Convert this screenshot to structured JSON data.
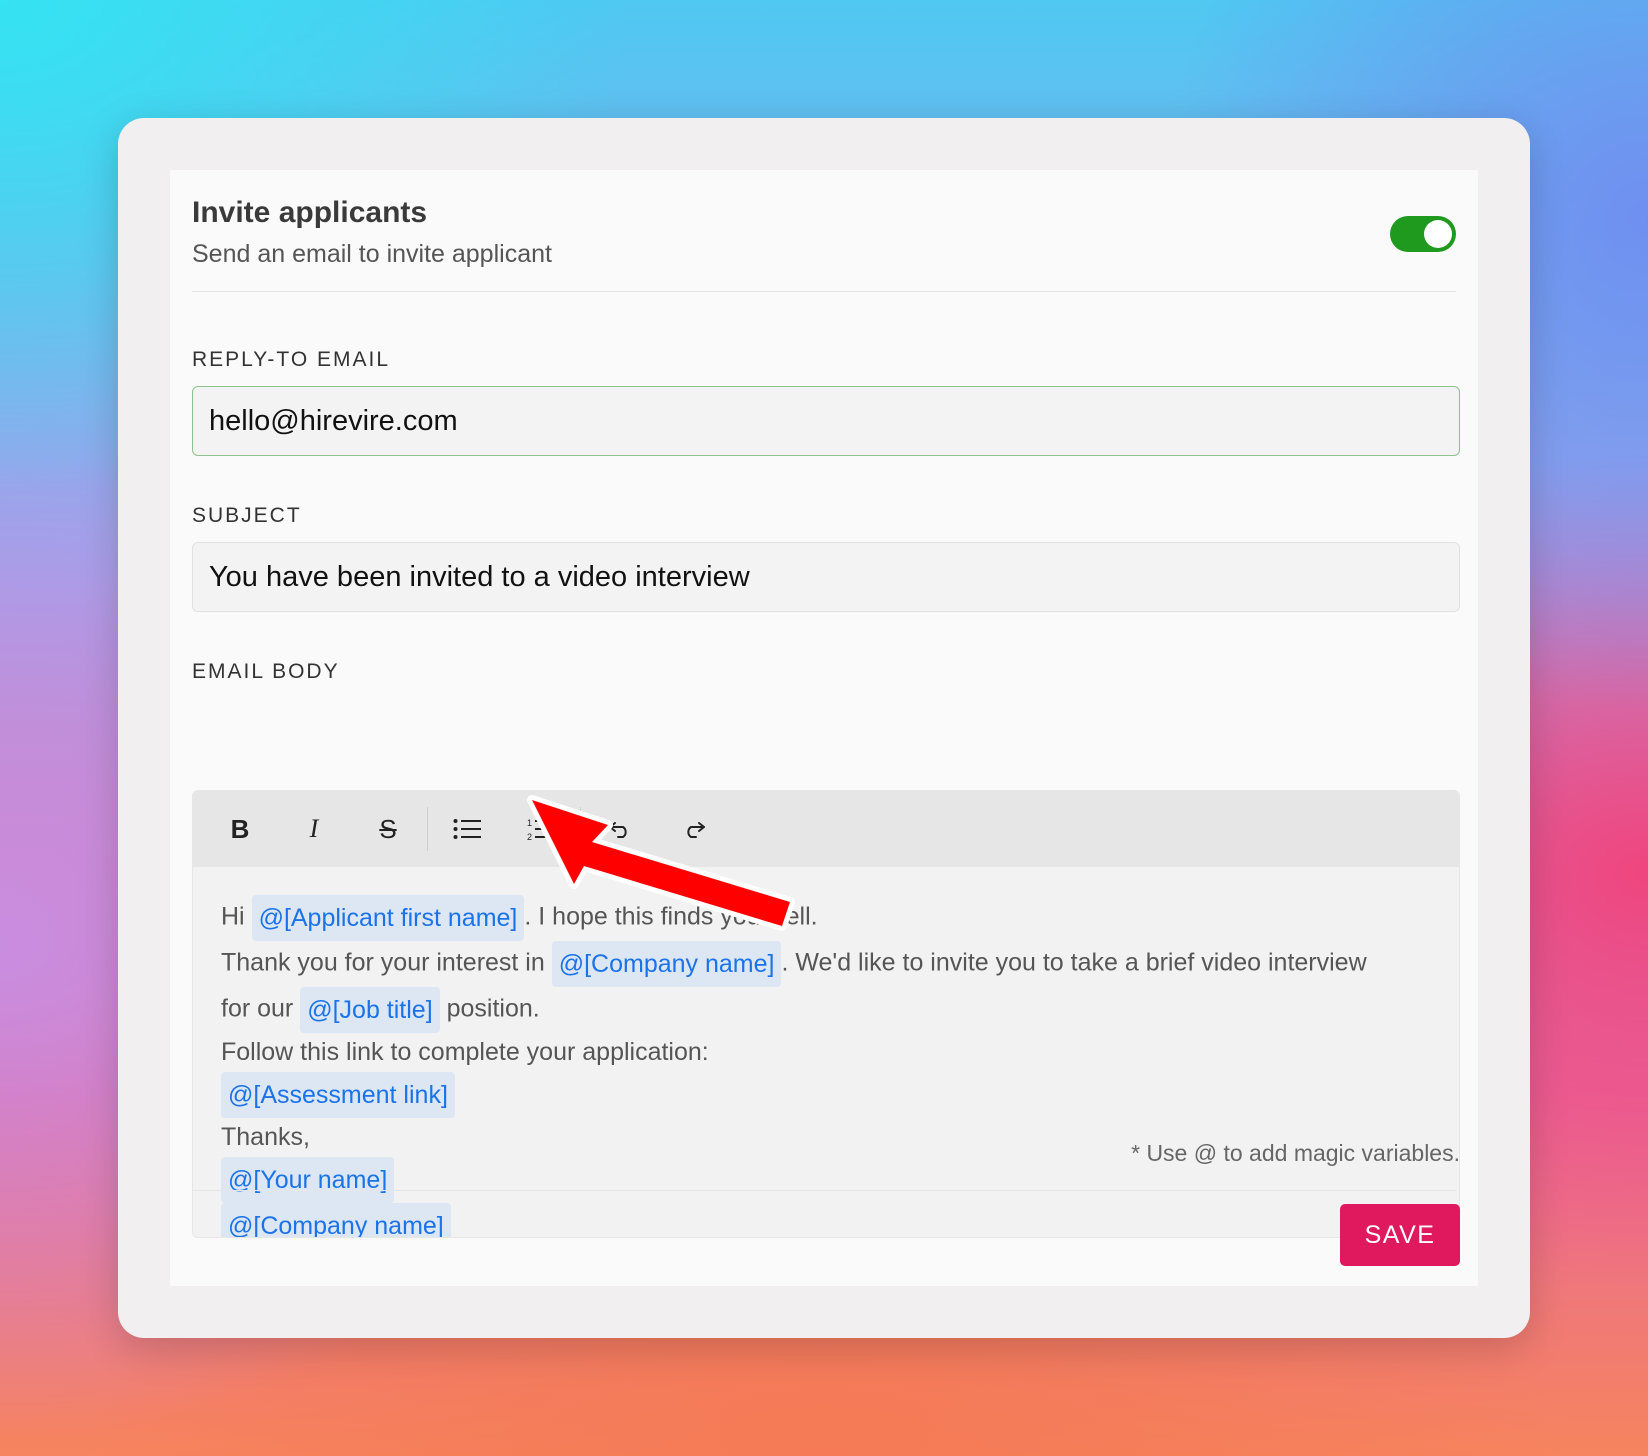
{
  "header": {
    "title": "Invite applicants",
    "subtitle": "Send an email to invite applicant",
    "toggle_on": true
  },
  "reply_to": {
    "label": "REPLY-TO EMAIL",
    "value": "hello@hirevire.com"
  },
  "subject": {
    "label": "SUBJECT",
    "value": "You have been invited to a video interview"
  },
  "email_body": {
    "label": "EMAIL BODY",
    "toolbar": {
      "bold": "B",
      "italic": "I",
      "strike": "S",
      "bullet_list": "bulleted-list-icon",
      "numbered_list": "numbered-list-icon",
      "undo": "undo-icon",
      "redo": "redo-icon"
    },
    "greeting": "Hi",
    "var_applicant_first_name": "@[Applicant first name]",
    "text_hope": ". I hope this finds you well.",
    "text_thank": "Thank you for your interest in",
    "var_company_name_1": "@[Company name]",
    "text_invite": ". We'd like to invite you to take a brief video interview",
    "text_for_our": "for our",
    "var_job_title": "@[Job title]",
    "text_position": "position.",
    "text_follow": "Follow this link to complete your application:",
    "var_assessment_link": "@[Assessment link]",
    "text_thanks": "Thanks,",
    "var_your_name": "@[Your name]",
    "var_company_name_2": "@[Company name]"
  },
  "hint": "* Use @ to add magic variables.",
  "save_label": "SAVE",
  "colors": {
    "toggle": "#1f9a1f",
    "save": "#e0195f",
    "variable_text": "#1a73e8",
    "variable_bg": "#dde6f3",
    "arrow": "#ff0000"
  }
}
